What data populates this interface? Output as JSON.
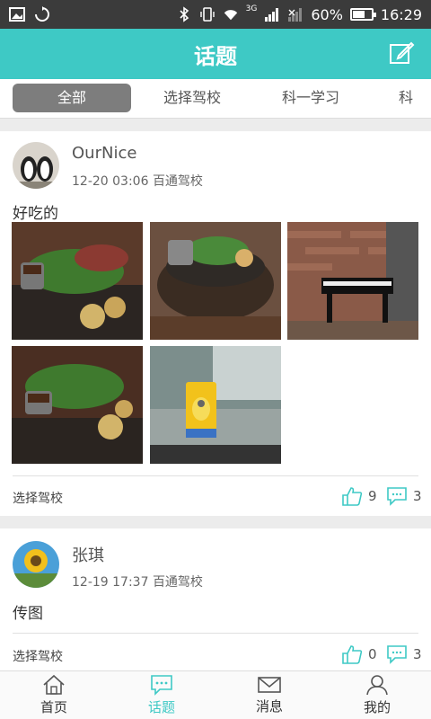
{
  "status": {
    "battery_text": "60%",
    "time": "16:29",
    "network": "3G",
    "battery_level": 0.6
  },
  "header": {
    "title": "话题"
  },
  "tabs": [
    {
      "label": "全部"
    },
    {
      "label": "选择驾校"
    },
    {
      "label": "科一学习"
    },
    {
      "label": "科"
    }
  ],
  "posts": [
    {
      "author": "OurNice",
      "time": "12-20 03:06",
      "school": "百通驾校",
      "text": "好吃的",
      "category": "选择驾校",
      "likes": "9",
      "comments": "3"
    },
    {
      "author": "张琪",
      "time": "12-19 17:37",
      "school": "百通驾校",
      "text": "传图",
      "category": "选择驾校",
      "likes": "0",
      "comments": "3"
    }
  ],
  "nav": [
    {
      "label": "首页",
      "icon": "home-icon"
    },
    {
      "label": "话题",
      "icon": "chat-icon"
    },
    {
      "label": "消息",
      "icon": "mail-icon"
    },
    {
      "label": "我的",
      "icon": "user-icon"
    }
  ],
  "colors": {
    "accent": "#3ec9c5",
    "active_tab": "#7d7d7d"
  }
}
